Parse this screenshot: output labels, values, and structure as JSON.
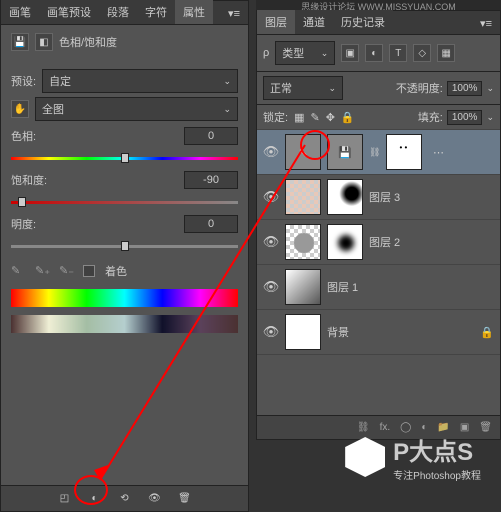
{
  "topbar": "思缘设计论坛  WWW.MISSYUAN.COM",
  "left": {
    "tabs": [
      "画笔",
      "画笔预设",
      "段落",
      "字符",
      "属性"
    ],
    "activeTab": 4,
    "title": "色相/饱和度",
    "preset": {
      "label": "预设:",
      "value": "自定"
    },
    "range": {
      "value": "全图"
    },
    "sliders": {
      "hue": {
        "label": "色相:",
        "value": "0",
        "pos": 50
      },
      "sat": {
        "label": "饱和度:",
        "value": "-90",
        "pos": 5
      },
      "light": {
        "label": "明度:",
        "value": "0",
        "pos": 50
      }
    },
    "colorize": "着色",
    "bottomIcons": [
      "clip",
      "reset",
      "view",
      "visibility",
      "delete"
    ]
  },
  "right": {
    "tabs": [
      "图层",
      "通道",
      "历史记录"
    ],
    "activeTab": 0,
    "kind": {
      "label": "类型"
    },
    "blend": {
      "value": "正常"
    },
    "opacity": {
      "label": "不透明度:",
      "value": "100%"
    },
    "lock": {
      "label": "锁定:",
      "fill": {
        "label": "填充:",
        "value": "100%"
      }
    },
    "layers": [
      {
        "name": "",
        "sel": true,
        "hasMenu": true,
        "adj": true
      },
      {
        "name": "图层 3"
      },
      {
        "name": "图层 2"
      },
      {
        "name": "图层 1"
      },
      {
        "name": "背景",
        "locked": true
      }
    ],
    "btm": [
      "link",
      "fx",
      "mask",
      "adj",
      "group",
      "new",
      "del"
    ]
  },
  "logo": {
    "big": "P大点S",
    "sub": "专注Photoshop教程"
  }
}
